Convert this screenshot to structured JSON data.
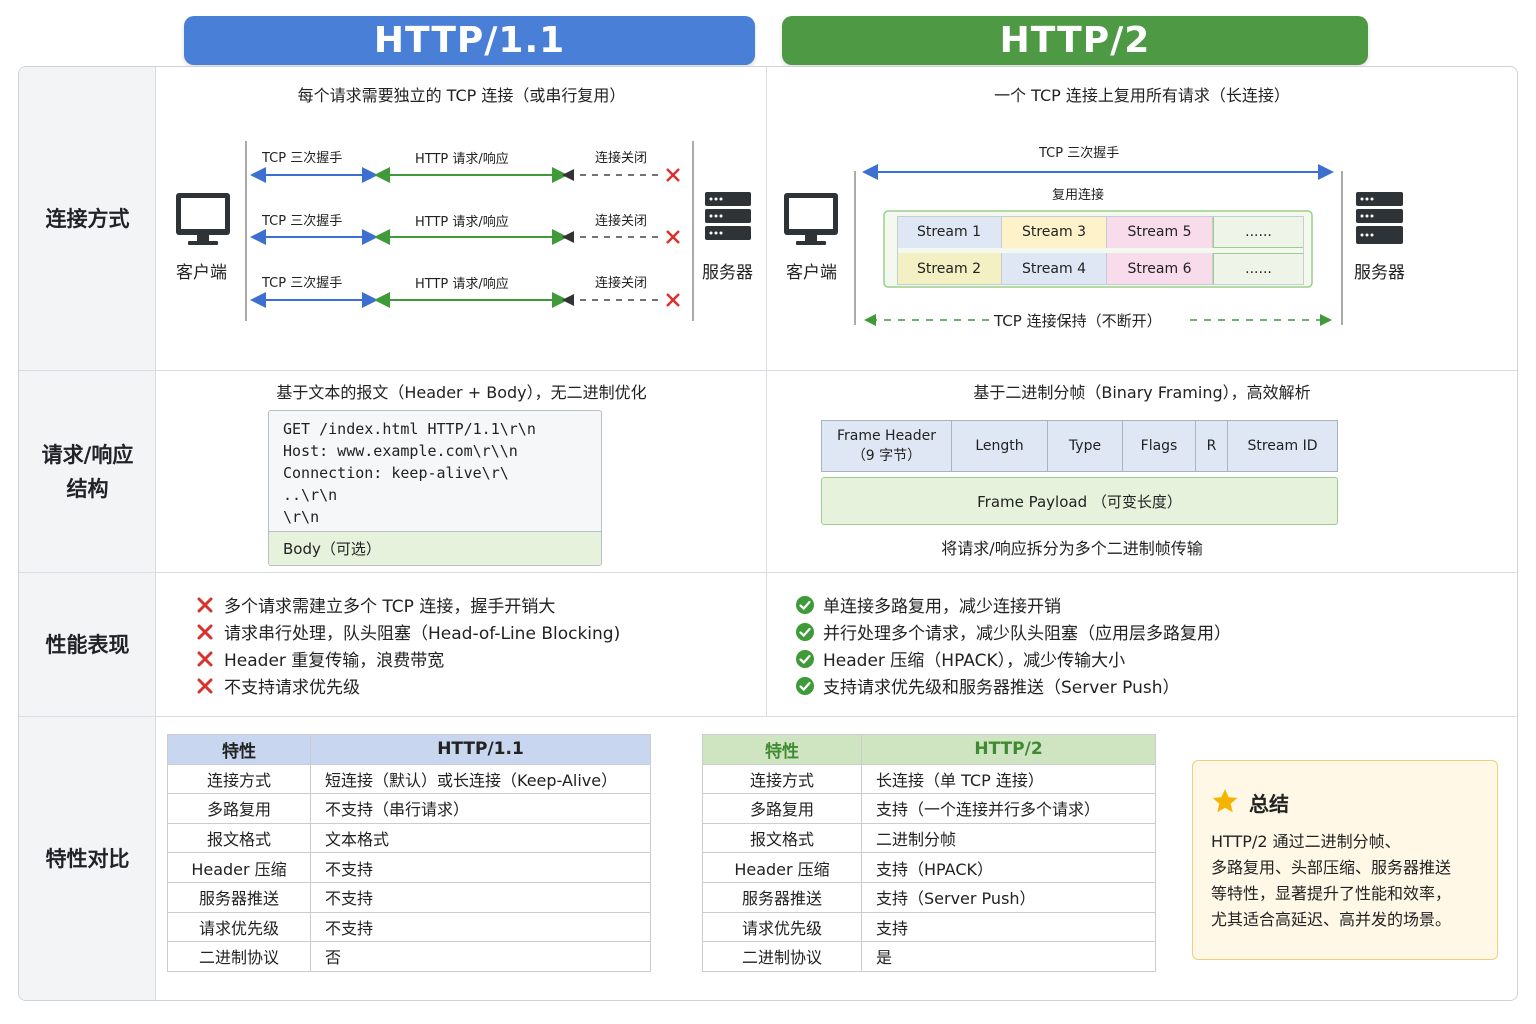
{
  "header": {
    "left_title": "HTTP/1.1",
    "right_title": "HTTP/2",
    "left_color": "#4a7fd8",
    "right_color": "#4e9a44"
  },
  "rows": {
    "connection": "连接方式",
    "structure_line1": "请求/响应",
    "structure_line2": "结构",
    "performance": "性能表现",
    "comparison": "特性对比"
  },
  "connection": {
    "http1": {
      "subtitle": "每个请求需要独立的 TCP 连接（或串行复用）",
      "client": "客户端",
      "server": "服务器",
      "lanes": [
        {
          "handshake": "TCP 三次握手",
          "request": "HTTP 请求/响应",
          "close": "连接关闭"
        },
        {
          "handshake": "TCP 三次握手",
          "request": "HTTP 请求/响应",
          "close": "连接关闭"
        },
        {
          "handshake": "TCP 三次握手",
          "request": "HTTP 请求/响应",
          "close": "连接关闭"
        }
      ]
    },
    "http2": {
      "subtitle": "一个 TCP 连接上复用所有请求（长连接）",
      "client": "客户端",
      "server": "服务器",
      "handshake": "TCP 三次握手",
      "multiplex": "复用连接",
      "streams_row1": [
        "Stream 1",
        "Stream 3",
        "Stream 5",
        "......"
      ],
      "streams_row2": [
        "Stream 2",
        "Stream 4",
        "Stream 6",
        "......"
      ],
      "keepalive": "TCP 连接保持（不断开）"
    }
  },
  "structure": {
    "http1": {
      "subtitle": "基于文本的报文（Header + Body），无二进制优化",
      "code": "GET /index.html HTTP/1.1\\r\\n\nHost: www.example.com\\r\\\\n\nConnection: keep-alive\\r\\\n..\\r\\n\n\\r\\n",
      "body": "Body（可选）"
    },
    "http2": {
      "subtitle": "基于二进制分帧（Binary Framing），高效解析",
      "frame_header_line1": "Frame Header",
      "frame_header_line2": "（9 字节）",
      "fields": [
        "Length",
        "Type",
        "Flags",
        "R",
        "Stream ID"
      ],
      "payload": "Frame Payload （可变长度）",
      "caption": "将请求/响应拆分为多个二进制帧传输"
    }
  },
  "performance": {
    "http1": [
      "多个请求需建立多个 TCP 连接，握手开销大",
      "请求串行处理，队头阻塞（Head-of-Line Blocking)",
      "Header 重复传输，浪费带宽",
      "不支持请求优先级"
    ],
    "http2": [
      "单连接多路复用，减少连接开销",
      "并行处理多个请求，减少队头阻塞（应用层多路复用）",
      "Header 压缩（HPACK），减少传输大小",
      "支持请求优先级和服务器推送（Server Push）"
    ]
  },
  "comparison": {
    "http1": {
      "headers": [
        "特性",
        "HTTP/1.1"
      ],
      "rows": [
        [
          "连接方式",
          "短连接（默认）或长连接（Keep-Alive）"
        ],
        [
          "多路复用",
          "不支持（串行请求）"
        ],
        [
          "报文格式",
          "文本格式"
        ],
        [
          "Header 压缩",
          "不支持"
        ],
        [
          "服务器推送",
          "不支持"
        ],
        [
          "请求优先级",
          "不支持"
        ],
        [
          "二进制协议",
          "否"
        ]
      ]
    },
    "http2": {
      "headers": [
        "特性",
        "HTTP/2"
      ],
      "rows": [
        [
          "连接方式",
          "长连接（单 TCP 连接）"
        ],
        [
          "多路复用",
          "支持（一个连接并行多个请求）"
        ],
        [
          "报文格式",
          "二进制分帧"
        ],
        [
          "Header 压缩",
          "支持（HPACK）"
        ],
        [
          "服务器推送",
          "支持（Server Push）"
        ],
        [
          "请求优先级",
          "支持"
        ],
        [
          "二进制协议",
          "是"
        ]
      ]
    },
    "summary": {
      "title": "总结",
      "lines": [
        "HTTP/2 通过二进制分帧、",
        "多路复用、头部压缩、服务器推送",
        "等特性，显著提升了性能和效率，",
        "尤其适合高延迟、高并发的场景。"
      ]
    }
  }
}
